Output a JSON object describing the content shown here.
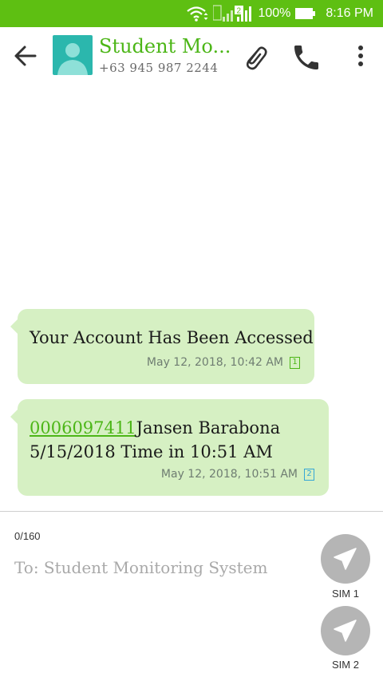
{
  "status_bar": {
    "sim_indicator": "2",
    "battery_percent": "100%",
    "time": "8:16 PM"
  },
  "header": {
    "contact_name": "Student Mo...",
    "contact_number": "+63 945 987 2244"
  },
  "messages": [
    {
      "text": "Your Account Has Been Accessed",
      "timestamp": "May 12, 2018, 10:42 AM",
      "sim": "1"
    },
    {
      "link_text": "0006097411",
      "text_line1_rest": "Jansen Barabona",
      "text_line2": "5/15/2018 Time in 10:51 AM",
      "timestamp": "May 12, 2018, 10:51 AM",
      "sim": "2"
    }
  ],
  "compose": {
    "char_count": "0/160",
    "placeholder": "To: Student Monitoring System"
  },
  "send_buttons": [
    {
      "label": "SIM 1"
    },
    {
      "label": "SIM 2"
    }
  ],
  "colors": {
    "status_bar": "#5ebf12",
    "accent": "#4cb617",
    "bubble": "#d6f0c3",
    "avatar": "#2bb7ad",
    "send_button": "#b5b5b5"
  },
  "icons": [
    "wifi-icon",
    "signal-icon",
    "battery-icon",
    "back-arrow-icon",
    "avatar-icon",
    "paperclip-icon",
    "phone-icon",
    "more-vert-icon",
    "send-icon"
  ]
}
